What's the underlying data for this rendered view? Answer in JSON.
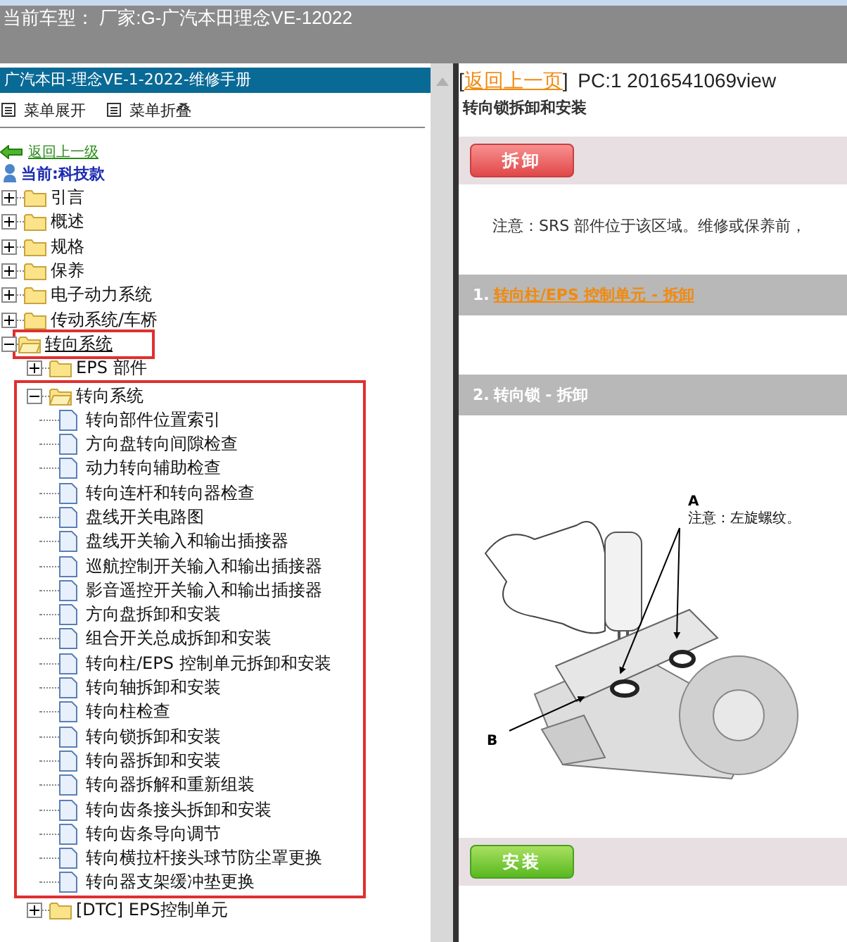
{
  "header": {
    "title": "当前车型： 厂家:G-广汽本田理念VE-12022"
  },
  "sidebar": {
    "title": "广汽本田-理念VE-1-2022-维修手册",
    "menu_actions": [
      "菜单展开",
      "菜单折叠"
    ],
    "back_link": "返回上一级",
    "current": "当前:科技款",
    "tree": [
      {
        "kind": "folder",
        "label": "引言",
        "expanded": false
      },
      {
        "kind": "folder",
        "label": "概述",
        "expanded": false
      },
      {
        "kind": "folder",
        "label": "规格",
        "expanded": false
      },
      {
        "kind": "folder",
        "label": "保养",
        "expanded": false
      },
      {
        "kind": "folder",
        "label": "电子动力系统",
        "expanded": false
      },
      {
        "kind": "folder",
        "label": "传动系统/车桥",
        "expanded": false
      },
      {
        "kind": "folder",
        "label": "转向系统",
        "expanded": true,
        "highlighted_row": true,
        "children": [
          {
            "kind": "folder",
            "label": "EPS 部件",
            "expanded": false
          },
          {
            "kind": "folder",
            "label": "转向系统",
            "expanded": true,
            "highlighted_block": true,
            "children": [
              {
                "kind": "doc",
                "label": "转向部件位置索引"
              },
              {
                "kind": "doc",
                "label": "方向盘转向间隙检查"
              },
              {
                "kind": "doc",
                "label": "动力转向辅助检查"
              },
              {
                "kind": "doc",
                "label": "转向连杆和转向器检查"
              },
              {
                "kind": "doc",
                "label": "盘线开关电路图"
              },
              {
                "kind": "doc",
                "label": "盘线开关输入和输出插接器"
              },
              {
                "kind": "doc",
                "label": "巡航控制开关输入和输出插接器"
              },
              {
                "kind": "doc",
                "label": "影音遥控开关输入和输出插接器"
              },
              {
                "kind": "doc",
                "label": "方向盘拆卸和安装"
              },
              {
                "kind": "doc",
                "label": "组合开关总成拆卸和安装"
              },
              {
                "kind": "doc",
                "label": "转向柱/EPS 控制单元拆卸和安装"
              },
              {
                "kind": "doc",
                "label": "转向轴拆卸和安装"
              },
              {
                "kind": "doc",
                "label": "转向柱检查"
              },
              {
                "kind": "doc",
                "label": "转向锁拆卸和安装"
              },
              {
                "kind": "doc",
                "label": "转向器拆卸和安装"
              },
              {
                "kind": "doc",
                "label": "转向器拆解和重新组装"
              },
              {
                "kind": "doc",
                "label": "转向齿条接头拆卸和安装"
              },
              {
                "kind": "doc",
                "label": "转向齿条导向调节"
              },
              {
                "kind": "doc",
                "label": "转向横拉杆接头球节防尘罩更换"
              },
              {
                "kind": "doc",
                "label": "转向器支架缓冲垫更换"
              }
            ]
          },
          {
            "kind": "folder",
            "label": "[DTC] EPS控制单元",
            "expanded": false
          }
        ]
      }
    ]
  },
  "content": {
    "back_link": {
      "open": "[",
      "label": "返回上一页",
      "close": "]"
    },
    "page_code": "PC:1 2016541069view",
    "title": "转向锁拆卸和安装",
    "sections": [
      {
        "kind": "removal",
        "button": "拆卸",
        "note": "注意：SRS 部件位于该区域。维修或保养前，",
        "steps": [
          {
            "number": "1.",
            "title": "转向柱/EPS 控制单元 - 拆卸",
            "link": true
          },
          {
            "number": "2.",
            "title": "转向锁 - 拆卸",
            "link": false,
            "figure": {
              "label_a": "A",
              "note": "注意：左旋螺纹。",
              "label_b": "B"
            }
          }
        ]
      },
      {
        "kind": "install",
        "button": "安装"
      }
    ]
  }
}
